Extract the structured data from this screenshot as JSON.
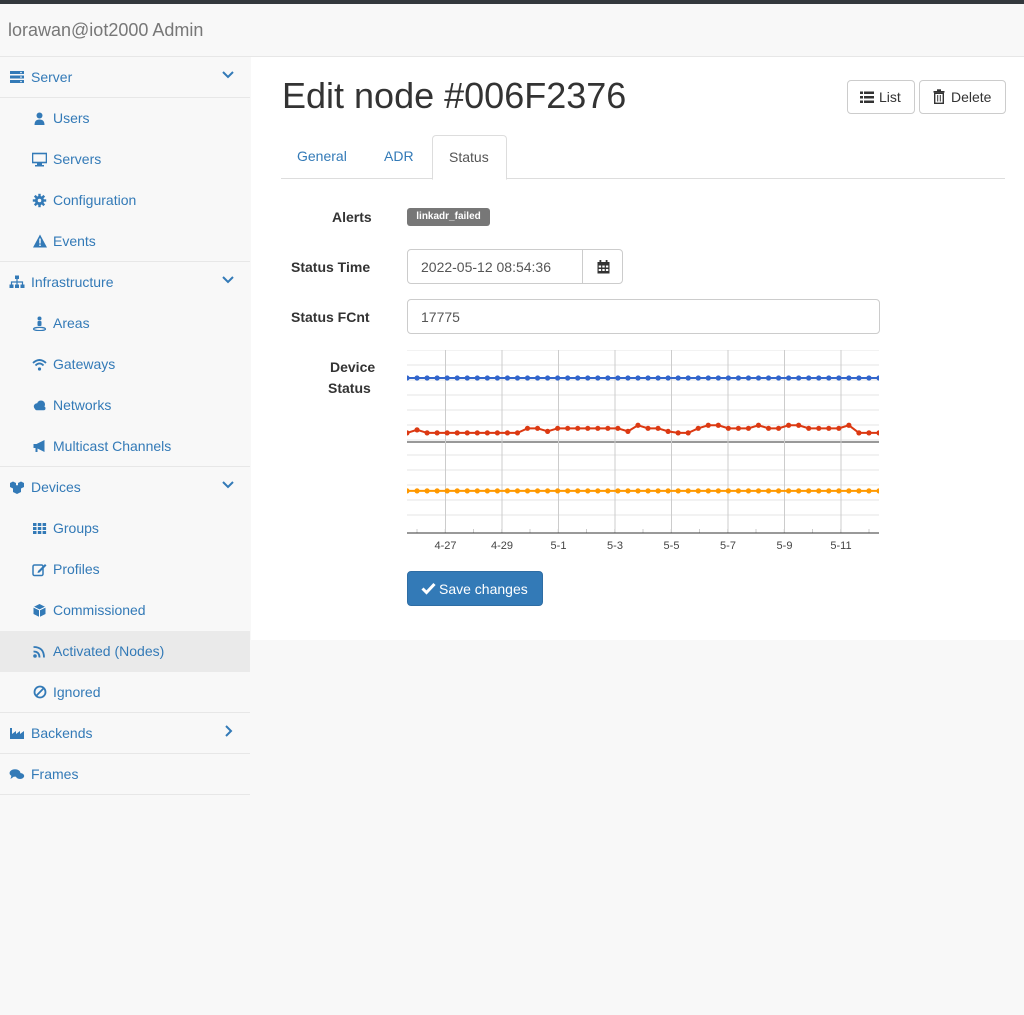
{
  "app": {
    "title": "lorawan@iot2000 Admin"
  },
  "sidebar": {
    "server": {
      "label": "Server",
      "items": [
        "Users",
        "Servers",
        "Configuration",
        "Events"
      ]
    },
    "infrastructure": {
      "label": "Infrastructure",
      "items": [
        "Areas",
        "Gateways",
        "Networks",
        "Multicast Channels"
      ]
    },
    "devices": {
      "label": "Devices",
      "items": [
        "Groups",
        "Profiles",
        "Commissioned",
        "Activated (Nodes)",
        "Ignored"
      ]
    },
    "backends": {
      "label": "Backends"
    },
    "frames": {
      "label": "Frames"
    }
  },
  "page": {
    "title": "Edit node #006F2376",
    "list_label": "List",
    "delete_label": "Delete"
  },
  "tabs": [
    "General",
    "ADR",
    "Status"
  ],
  "form": {
    "alerts_label": "Alerts",
    "alert_badge": "linkadr_failed",
    "status_time_label": "Status Time",
    "status_time_value": "2022-05-12 08:54:36",
    "status_fcnt_label": "Status FCnt",
    "status_fcnt_value": "17775",
    "device_status_label_1": "Device",
    "device_status_label_2": "Status",
    "save_label": "Save changes"
  },
  "colors": {
    "link": "#337ab7",
    "series_blue": "#3366cc",
    "series_red": "#dc3912",
    "series_orange": "#ff9900",
    "badge": "#777777"
  },
  "chart_data": {
    "type": "line",
    "x_tick_labels": [
      "4-27",
      "4-29",
      "5-1",
      "5-3",
      "5-5",
      "5-7",
      "5-9",
      "5-11"
    ],
    "points_per_series": 48,
    "series": [
      {
        "values": [
          0.8,
          0.8,
          0.8,
          0.8,
          0.8,
          0.8,
          0.8,
          0.8,
          0.8,
          0.8,
          0.8,
          0.8,
          0.8,
          0.8,
          0.8,
          0.8,
          0.8,
          0.8,
          0.8,
          0.8,
          0.8,
          0.8,
          0.8,
          0.8,
          0.8,
          0.8,
          0.8,
          0.8,
          0.8,
          0.8,
          0.8,
          0.8,
          0.8,
          0.8,
          0.8,
          0.8,
          0.8,
          0.8,
          0.8,
          0.8,
          0.8,
          0.8,
          0.8,
          0.8,
          0.8,
          0.8,
          0.8,
          0.8
        ]
      },
      {
        "values": [
          0.44,
          0.46,
          0.44,
          0.44,
          0.44,
          0.44,
          0.44,
          0.44,
          0.44,
          0.44,
          0.44,
          0.44,
          0.47,
          0.47,
          0.45,
          0.47,
          0.47,
          0.47,
          0.47,
          0.47,
          0.47,
          0.47,
          0.45,
          0.49,
          0.47,
          0.47,
          0.45,
          0.44,
          0.44,
          0.47,
          0.49,
          0.49,
          0.47,
          0.47,
          0.47,
          0.49,
          0.47,
          0.47,
          0.49,
          0.49,
          0.47,
          0.47,
          0.47,
          0.47,
          0.49,
          0.44,
          0.44,
          0.44
        ]
      },
      {
        "values": [
          0.06,
          0.06,
          0.06,
          0.06,
          0.06,
          0.06,
          0.06,
          0.06,
          0.06,
          0.06,
          0.06,
          0.06,
          0.06,
          0.06,
          0.06,
          0.06,
          0.06,
          0.06,
          0.06,
          0.06,
          0.06,
          0.06,
          0.06,
          0.06,
          0.06,
          0.06,
          0.06,
          0.06,
          0.06,
          0.06,
          0.06,
          0.06,
          0.06,
          0.06,
          0.06,
          0.06,
          0.06,
          0.06,
          0.06,
          0.06,
          0.06,
          0.06,
          0.06,
          0.06,
          0.06,
          0.06,
          0.06,
          0.06
        ]
      }
    ]
  }
}
